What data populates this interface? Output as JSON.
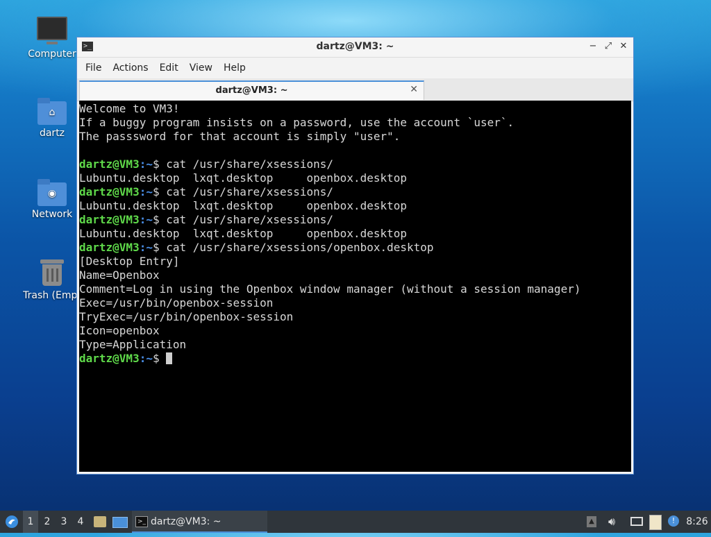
{
  "desktop": {
    "icons": [
      {
        "label": "Computer",
        "icon": "computer-icon"
      },
      {
        "label": "dartz",
        "icon": "home-folder-icon"
      },
      {
        "label": "Network",
        "icon": "network-folder-icon"
      },
      {
        "label": "Trash (Empt",
        "icon": "trash-icon"
      }
    ]
  },
  "window": {
    "title": "dartz@VM3: ~",
    "menu": [
      "File",
      "Actions",
      "Edit",
      "View",
      "Help"
    ],
    "tab_label": "dartz@VM3: ~",
    "controls": {
      "minimize": "−",
      "maximize": "⤢",
      "close": "✕"
    }
  },
  "terminal": {
    "welcome": [
      "Welcome to VM3!",
      "If a buggy program insists on a password, use the account `user`.",
      "The passsword for that account is simply \"user\"."
    ],
    "prompt_user": "dartz@VM3",
    "prompt_path": ":~",
    "prompt_symbol": "$",
    "cmd1": " cat /usr/share/xsessions/",
    "ls_out": "Lubuntu.desktop  lxqt.desktop     openbox.desktop",
    "cmd2": " cat /usr/share/xsessions/openbox.desktop",
    "file_lines": [
      "[Desktop Entry]",
      "Name=Openbox",
      "Comment=Log in using the Openbox window manager (without a session manager)",
      "Exec=/usr/bin/openbox-session",
      "TryExec=/usr/bin/openbox-session",
      "Icon=openbox",
      "Type=Application"
    ]
  },
  "taskbar": {
    "workspaces": [
      "1",
      "2",
      "3",
      "4"
    ],
    "active_workspace": "1",
    "task_label": "dartz@VM3: ~",
    "clock": "8:26"
  }
}
